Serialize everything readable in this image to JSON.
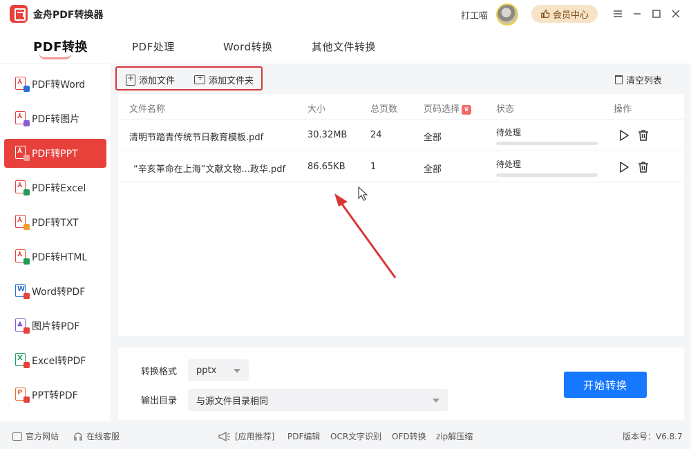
{
  "app": {
    "title": "金舟PDF转换器",
    "user_name": "打工喵",
    "vip_label": "会员中心"
  },
  "tabs": [
    {
      "label": "PDF转换"
    },
    {
      "label": "PDF处理"
    },
    {
      "label": "Word转换"
    },
    {
      "label": "其他文件转换"
    }
  ],
  "sidebar": {
    "items": [
      {
        "label": "PDF转Word",
        "badge_color": "#2b6fd6"
      },
      {
        "label": "PDF转图片",
        "badge_color": "#8a5cd6"
      },
      {
        "label": "PDF转PPT",
        "badge_color": "#e8413c"
      },
      {
        "label": "PDF转Excel",
        "badge_color": "#1f9d55"
      },
      {
        "label": "PDF转TXT",
        "badge_color": "#f0a030"
      },
      {
        "label": "PDF转HTML",
        "badge_color": "#1f9d55"
      },
      {
        "label": "Word转PDF",
        "badge_color": "#2b6fd6"
      },
      {
        "label": "图片转PDF",
        "badge_color": "#8a5cd6"
      },
      {
        "label": "Excel转PDF",
        "badge_color": "#1f9d55"
      },
      {
        "label": "PPT转PDF",
        "badge_color": "#f06a30"
      }
    ],
    "active_index": 2
  },
  "toolbar": {
    "add_file": "添加文件",
    "add_folder": "添加文件夹",
    "clear_list": "清空列表"
  },
  "table": {
    "headers": {
      "name": "文件名称",
      "size": "大小",
      "pages": "总页数",
      "range": "页码选择",
      "status": "状态",
      "actions": "操作"
    },
    "rows": [
      {
        "name": "清明节踏青传统节日教育模板.pdf",
        "size": "30.32MB",
        "pages": "24",
        "range": "全部",
        "status": "待处理",
        "progress": 0
      },
      {
        "name": "“辛亥革命在上海”文献文物...政华.pdf",
        "size": "86.65KB",
        "pages": "1",
        "range": "全部",
        "status": "待处理",
        "progress": 0
      }
    ]
  },
  "settings": {
    "format_label": "转换格式",
    "format_value": "pptx",
    "output_label": "输出目录",
    "output_value": "与源文件目录相同",
    "start_label": "开始转换"
  },
  "footer": {
    "website": "官方网站",
    "service": "在线客服",
    "recommend": "[应用推荐]",
    "links": [
      "PDF编辑",
      "OCR文字识别",
      "OFD转换",
      "zip解压缩"
    ],
    "version": "版本号：V6.8.7"
  },
  "colors": {
    "brand_red": "#e8413c",
    "primary_blue": "#1677ff",
    "highlight_border": "#d93636"
  }
}
